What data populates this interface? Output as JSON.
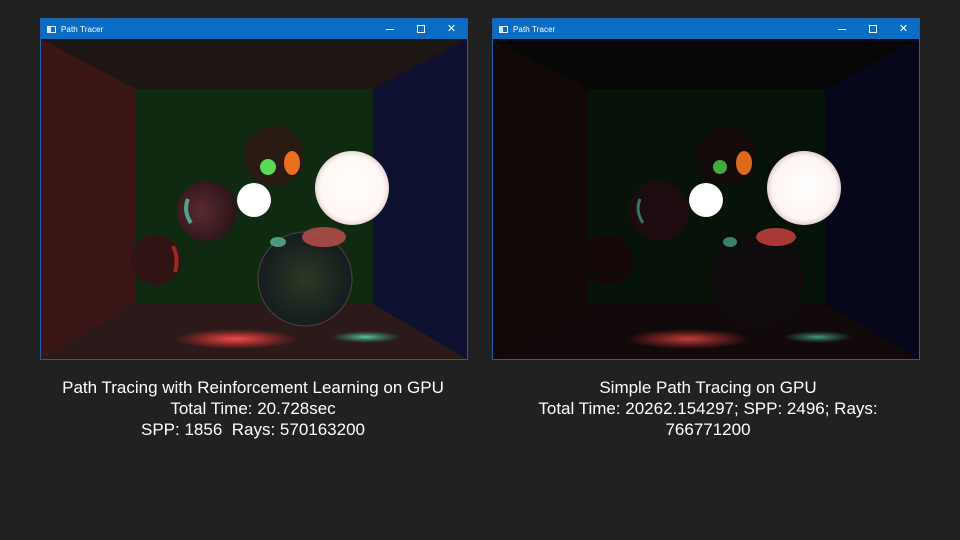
{
  "windows": {
    "left": {
      "title": "Path Tracer",
      "title_icon": "app-window-icon",
      "controls": [
        "minimize-icon",
        "maximize-icon",
        "close-icon"
      ]
    },
    "right": {
      "title": "Path Tracer",
      "title_icon": "app-window-icon",
      "controls": [
        "minimize-icon",
        "maximize-icon",
        "close-icon"
      ]
    }
  },
  "captions": {
    "left": {
      "line1": "Path Tracing with Reinforcement Learning on GPU",
      "line2": "Total Time: 20.728sec",
      "line3": "SPP: 1856  Rays: 570163200"
    },
    "right": {
      "line1": "Simple Path Tracing on GPU",
      "line2": "Total Time: 20262.154297; SPP: 2496; Rays: 766771200"
    }
  },
  "colors": {
    "background": "#212121",
    "titlebar": "#0b6cc4",
    "window_border": "#1f5fa8",
    "caption_text": "#ffffff"
  }
}
